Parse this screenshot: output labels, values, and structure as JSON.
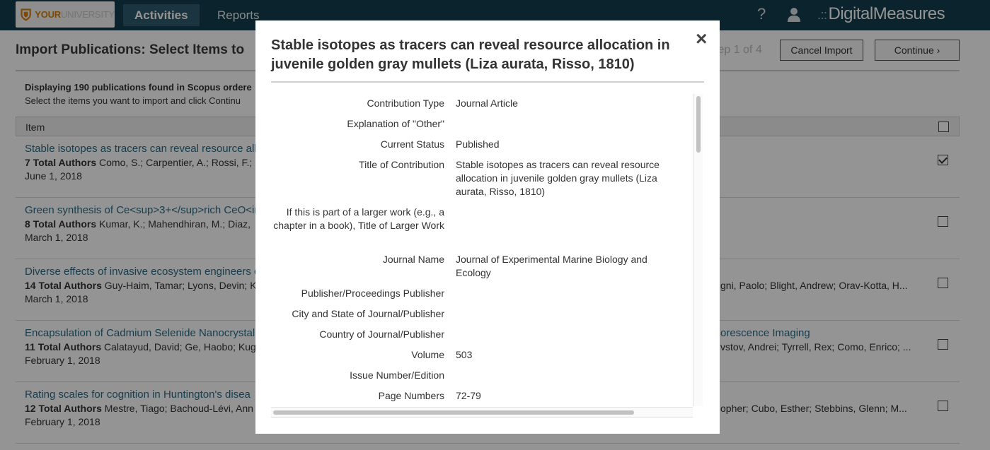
{
  "nav": {
    "logo_your": "YOUR",
    "logo_university": "UNIVERSITY",
    "tabs": [
      {
        "label": "Activities",
        "active": true
      },
      {
        "label": "Reports",
        "active": false
      }
    ],
    "help_icon": "?",
    "brand_dots": ".::",
    "brand_name": "DigitalMeasures"
  },
  "page": {
    "title": "Import Publications: Select Items to",
    "step": "tep 1 of 4",
    "cancel_label": "Cancel Import",
    "continue_label": "Continue ›",
    "info_line1": "Displaying 190 publications found in Scopus ordere",
    "info_line2": "Select the items you want to import and click Continu",
    "table_header": "Item"
  },
  "rows": [
    {
      "title": "Stable isotopes as tracers can reveal resource all",
      "authors_count": "7 Total Authors",
      "authors": "Como, S.; Carpentier, A.; Rossi, F.;",
      "date": "June 1, 2018",
      "right_title": "",
      "right_authors": "",
      "checked": true
    },
    {
      "title": "Green synthesis of Ce<sup>3+</sup>rich CeO<in",
      "authors_count": "8 Total Authors",
      "authors": "Kumar, K.; Mahendhiran, M.; Diaz,",
      "date": "March 1, 2018",
      "right_title": "",
      "right_authors": "",
      "checked": false
    },
    {
      "title": "Diverse effects of invasive ecosystem engineers o",
      "authors_count": "14 Total Authors",
      "authors": "Guy-Haim, Tamar; Lyons, Devin; K",
      "date": "March 1, 2018",
      "right_title": "",
      "right_authors": "gni, Paolo; Blight, Andrew; Orav-Kotta, H...",
      "checked": false
    },
    {
      "title": "Encapsulation of Cadmium Selenide Nanocrystal",
      "authors_count": "11 Total Authors",
      "authors": "Calatayud, David; Ge, Haobo; Kug",
      "date": "February 1, 2018",
      "right_title": "orescence Imaging",
      "right_authors": "vstov, Andrei; Tyrrell, Rex; Como, Enrico; ...",
      "checked": false
    },
    {
      "title": "Rating scales for cognition in Huntington's disea",
      "authors_count": "12 Total Authors",
      "authors": "Mestre, Tiago; Bachoud-Lévi, Ann",
      "date": "February 1, 2018",
      "right_title": "",
      "right_authors": "opher; Cubo, Esther; Stebbins, Glenn; M...",
      "checked": false
    }
  ],
  "modal": {
    "title": "Stable isotopes as tracers can reveal resource allocation in juvenile golden gray mullets (Liza aurata, Risso, 1810)",
    "close_icon": "×",
    "fields": [
      {
        "label": "Contribution Type",
        "value": "Journal Article"
      },
      {
        "label": "Explanation of \"Other\"",
        "value": ""
      },
      {
        "label": "Current Status",
        "value": "Published"
      },
      {
        "label": "Title of Contribution",
        "value": "Stable isotopes as tracers can reveal resource allocation in juvenile golden gray mullets (Liza aurata, Risso, 1810)"
      },
      {
        "label": "If this is part of a larger work (e.g., a chapter in a book), Title of Larger Work",
        "value": ""
      },
      {
        "label": "Journal Name",
        "value": "Journal of Experimental Marine Biology and Ecology"
      },
      {
        "label": "Publisher/Proceedings Publisher",
        "value": ""
      },
      {
        "label": "City and State of Journal/Publisher",
        "value": ""
      },
      {
        "label": "Country of Journal/Publisher",
        "value": ""
      },
      {
        "label": "Volume",
        "value": "503"
      },
      {
        "label": "Issue Number/Edition",
        "value": ""
      },
      {
        "label": "Page Numbers",
        "value": "72-79"
      }
    ]
  },
  "colors": {
    "nav_bg": "#123d4e",
    "nav_active": "#2f5c6e",
    "link": "#2a6b86",
    "logo_orange": "#d4800f"
  }
}
